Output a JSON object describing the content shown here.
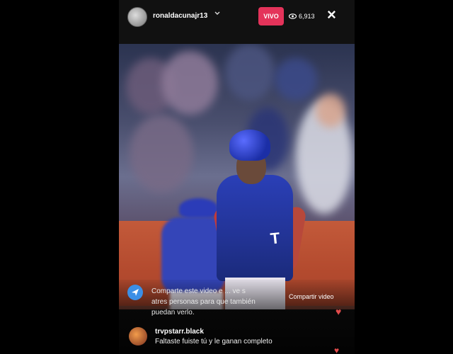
{
  "header": {
    "username": "ronaldacunajr13",
    "live_badge": "VIVO",
    "viewer_count": "6,913",
    "close_icon": "×"
  },
  "video": {
    "jersey_letter": "T"
  },
  "share_prompt": {
    "text": "Comparte este video e ... ve s\natres personas para que también puedan verlo.",
    "button_label": "Compartir video"
  },
  "comments": [
    {
      "username": "trvpstarr.black",
      "text": "Faltaste fuiste tú y le ganan completo"
    }
  ],
  "colors": {
    "live_badge": "#e4335a",
    "share_icon": "#3b8fe6",
    "heart": "#e14b4b",
    "jersey": "#2a3fb7",
    "wall": "#c35a3a"
  },
  "icons": {
    "close": "close-icon",
    "eye": "eye-icon",
    "chevron": "chevron-down-icon",
    "share": "share-icon",
    "heart": "heart-icon"
  }
}
